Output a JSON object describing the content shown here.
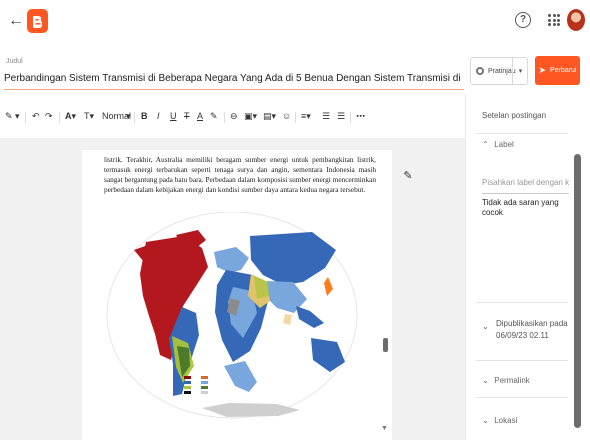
{
  "topbar": {
    "back_icon": "arrow-left-icon",
    "logo_icon": "blogger-logo",
    "help_icon": "help-circle-icon",
    "apps_icon": "grid-apps-icon",
    "avatar_icon": "user-avatar"
  },
  "title": {
    "label": "Judul",
    "value": "Perbandingan Sistem Transmisi di Beberapa Negara Yang Ada di 5 Benua Dengan Sistem Transmisi di Indonesia"
  },
  "actions": {
    "preview_label": "Pratinjau",
    "publish_label": "Perbarui"
  },
  "toolbar": {
    "items": [
      "pen-icon",
      "undo-icon",
      "redo-icon",
      "text-color-icon",
      "text-size-icon",
      "Normal",
      "B",
      "I",
      "U",
      "strike-icon",
      "A",
      "highlight-icon",
      "link-icon",
      "image-icon",
      "video-icon",
      "emoji-icon",
      "align-icon",
      "list-indent-icon",
      "list-outdent-icon",
      "more-icon"
    ],
    "paragraph_style": "Normal"
  },
  "document": {
    "text": "listrik. Terakhir, Australia memiliki beragam sumber energi untuk pembangkitan listrik, termasuk energi terbarukan seperti tenaga surya dan angin, sementara Indonesia masih sangat bergantung pada batu bara. Perbedaan dalam komposisi sumber energi mencerminkan perbedaan dalam kebijakan energi dan kondisi sumber daya antara kedua negara tersebut."
  },
  "sidebar": {
    "title": "Setelan postingan",
    "label_section": "Label",
    "label_placeholder": "Pisahkan label dengan ko...",
    "label_suggestion": "Tidak ada saran yang cocok",
    "published_label": "Dipublikasikan pada",
    "published_date": "06/09/23 02.11",
    "permalink_label": "Permalink",
    "location_label": "Lokasi"
  },
  "colors": {
    "accent": "#ff5722",
    "map_red": "#b3181f",
    "map_blue": "#3568b7",
    "map_light_blue": "#79a7dd",
    "map_green": "#a9c43a",
    "map_gray": "#cfcfcf"
  }
}
